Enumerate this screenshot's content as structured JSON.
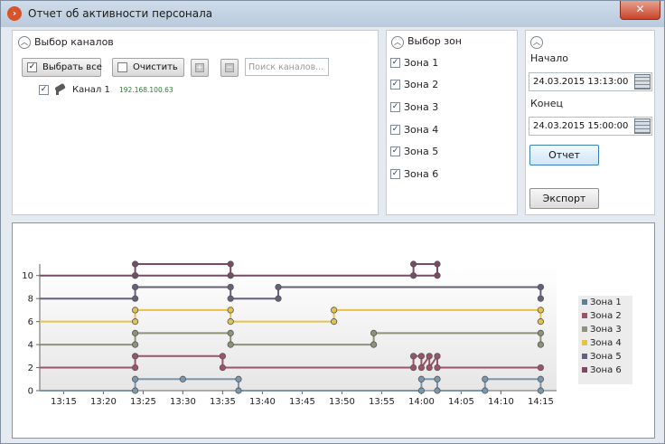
{
  "window": {
    "title": "Отчет об активности персонала",
    "close_label": "✕"
  },
  "channels": {
    "section_title": "Выбор каналов",
    "select_all_label": "Выбрать все",
    "clear_label": "Очистить",
    "search_placeholder": "Поиск каналов...",
    "items": [
      {
        "name": "Канал 1",
        "ip": "192.168.100.63",
        "checked": true
      }
    ]
  },
  "zones_panel": {
    "section_title": "Выбор зон",
    "items": [
      {
        "label": "Зона 1",
        "checked": true
      },
      {
        "label": "Зона 2",
        "checked": true
      },
      {
        "label": "Зона 3",
        "checked": true
      },
      {
        "label": "Зона 4",
        "checked": true
      },
      {
        "label": "Зона 5",
        "checked": true
      },
      {
        "label": "Зона 6",
        "checked": true
      }
    ]
  },
  "period": {
    "start_label": "Начало",
    "start_value": "24.03.2015 13:13:00",
    "end_label": "Конец",
    "end_value": "24.03.2015 15:00:00",
    "report_button": "Отчет",
    "export_button": "Экспорт"
  },
  "chart_data": {
    "type": "line",
    "step": true,
    "x_tick_labels": [
      "13:15",
      "13:20",
      "13:25",
      "13:30",
      "13:35",
      "13:40",
      "13:45",
      "13:50",
      "13:55",
      "14:00",
      "14:05",
      "14:10",
      "14:15"
    ],
    "x_tick_minutes": [
      795,
      800,
      805,
      810,
      815,
      820,
      825,
      830,
      835,
      840,
      845,
      850,
      855
    ],
    "xlim": [
      792,
      857
    ],
    "y_ticks": [
      "0",
      "2",
      "4",
      "6",
      "8",
      "10"
    ],
    "ylim": [
      0,
      11
    ],
    "grid": false,
    "legend_position": "right",
    "series": [
      {
        "name": "Зона 1",
        "color": "#7a98ad",
        "points": [
          [
            792,
            0
          ],
          [
            804,
            0
          ],
          [
            804,
            1
          ],
          [
            810,
            1
          ],
          [
            817,
            1
          ],
          [
            817,
            0
          ],
          [
            840,
            0
          ],
          [
            840,
            1
          ],
          [
            842,
            1
          ],
          [
            842,
            0
          ],
          [
            848,
            0
          ],
          [
            848,
            1
          ],
          [
            855,
            1
          ],
          [
            855,
            0
          ]
        ]
      },
      {
        "name": "Зона 2",
        "color": "#9a5468",
        "points": [
          [
            792,
            2
          ],
          [
            804,
            2
          ],
          [
            804,
            3
          ],
          [
            815,
            3
          ],
          [
            815,
            2
          ],
          [
            839,
            2
          ],
          [
            839,
            3
          ],
          [
            840,
            3
          ],
          [
            840,
            2
          ],
          [
            841,
            3
          ],
          [
            841,
            2
          ],
          [
            842,
            3
          ],
          [
            842,
            2
          ],
          [
            855,
            2
          ]
        ]
      },
      {
        "name": "Зона 3",
        "color": "#8e9278",
        "points": [
          [
            792,
            4
          ],
          [
            804,
            4
          ],
          [
            804,
            5
          ],
          [
            816,
            5
          ],
          [
            816,
            4
          ],
          [
            834,
            4
          ],
          [
            834,
            5
          ],
          [
            855,
            5
          ],
          [
            855,
            4
          ]
        ]
      },
      {
        "name": "Зона 4",
        "color": "#e6c24a",
        "points": [
          [
            792,
            6
          ],
          [
            804,
            6
          ],
          [
            804,
            7
          ],
          [
            816,
            7
          ],
          [
            816,
            6
          ],
          [
            829,
            6
          ],
          [
            829,
            7
          ],
          [
            855,
            7
          ],
          [
            855,
            6
          ]
        ]
      },
      {
        "name": "Зона 5",
        "color": "#67607c",
        "points": [
          [
            792,
            8
          ],
          [
            804,
            8
          ],
          [
            804,
            9
          ],
          [
            816,
            9
          ],
          [
            816,
            8
          ],
          [
            822,
            8
          ],
          [
            822,
            9
          ],
          [
            855,
            9
          ],
          [
            855,
            8
          ]
        ]
      },
      {
        "name": "Зона 6",
        "color": "#7a4a64",
        "points": [
          [
            792,
            10
          ],
          [
            804,
            10
          ],
          [
            804,
            11
          ],
          [
            816,
            11
          ],
          [
            816,
            10
          ],
          [
            839,
            10
          ],
          [
            839,
            11
          ],
          [
            842,
            11
          ],
          [
            842,
            10
          ],
          [
            804,
            10
          ]
        ]
      }
    ]
  }
}
